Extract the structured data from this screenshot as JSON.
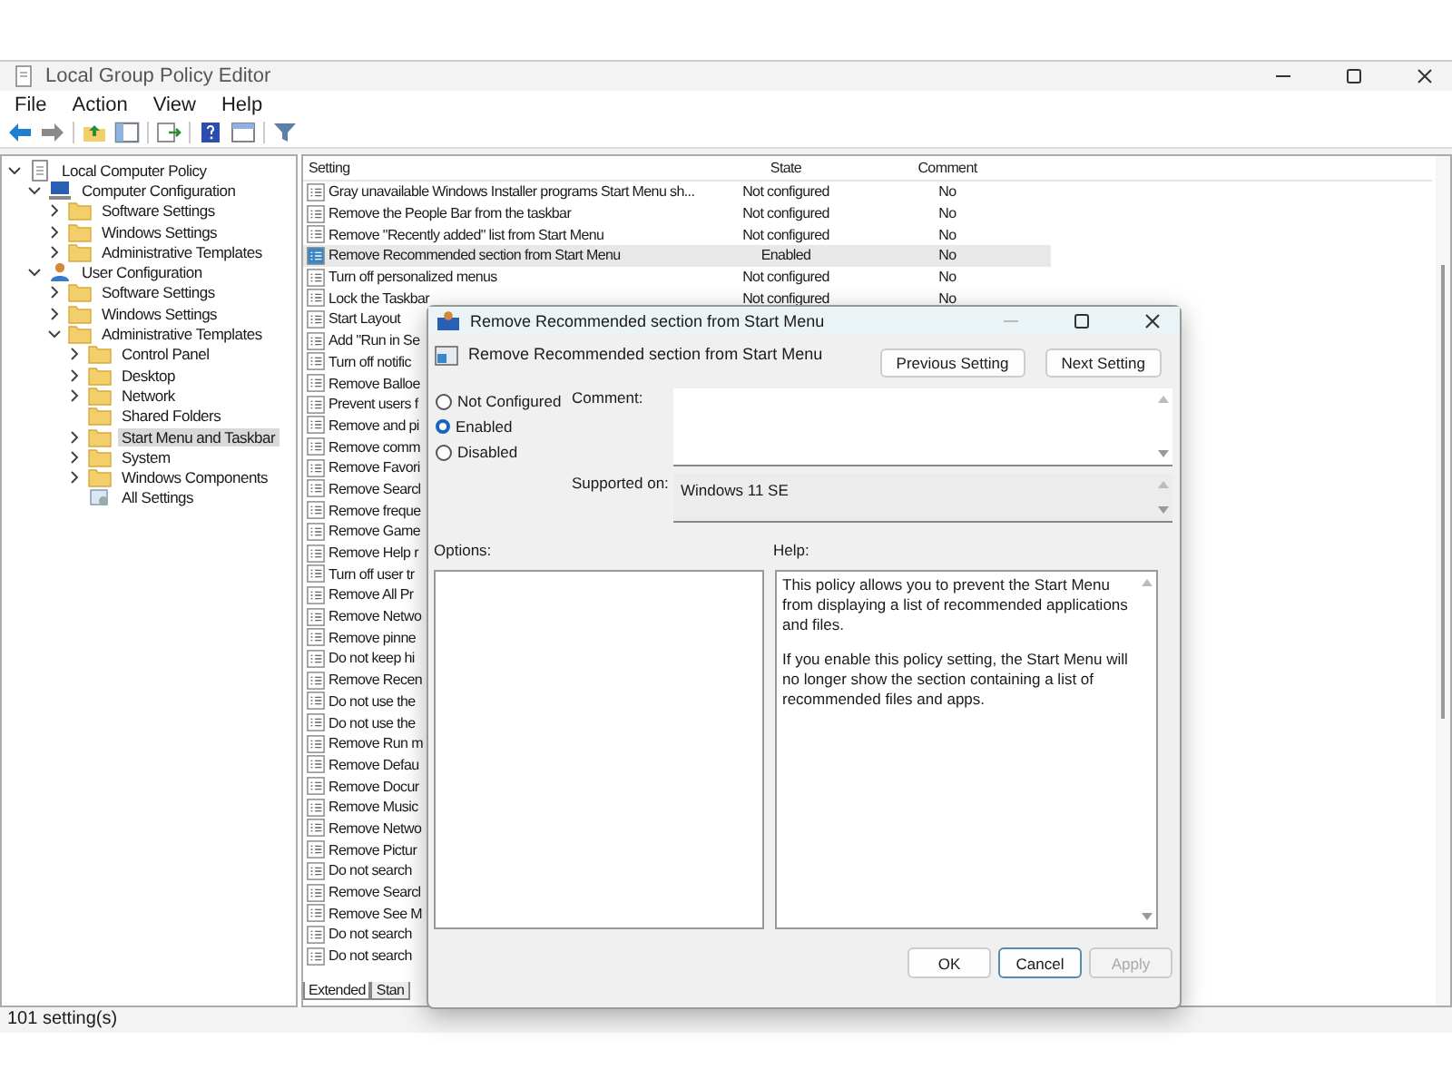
{
  "window": {
    "title": "Local Group Policy Editor"
  },
  "menu": [
    "File",
    "Action",
    "View",
    "Help"
  ],
  "tree": [
    {
      "label": "Local Computer Policy",
      "kind": "policy",
      "expanded": true,
      "selected": false,
      "children": [
        {
          "label": "Computer Configuration",
          "kind": "computer",
          "expanded": true,
          "selected": false,
          "children": [
            {
              "label": "Software Settings",
              "kind": "folder",
              "expanded": false,
              "selected": false
            },
            {
              "label": "Windows Settings",
              "kind": "folder",
              "expanded": false,
              "selected": false
            },
            {
              "label": "Administrative Templates",
              "kind": "folder",
              "expanded": false,
              "selected": false
            }
          ]
        },
        {
          "label": "User Configuration",
          "kind": "user",
          "expanded": true,
          "selected": false,
          "children": [
            {
              "label": "Software Settings",
              "kind": "folder",
              "expanded": false,
              "selected": false
            },
            {
              "label": "Windows Settings",
              "kind": "folder",
              "expanded": false,
              "selected": false
            },
            {
              "label": "Administrative Templates",
              "kind": "folder",
              "expanded": true,
              "selected": false,
              "children": [
                {
                  "label": "Control Panel",
                  "kind": "folder",
                  "expanded": false,
                  "selected": false
                },
                {
                  "label": "Desktop",
                  "kind": "folder",
                  "expanded": false,
                  "selected": false
                },
                {
                  "label": "Network",
                  "kind": "folder",
                  "expanded": false,
                  "selected": false
                },
                {
                  "label": "Shared Folders",
                  "kind": "leaf",
                  "selected": false
                },
                {
                  "label": "Start Menu and Taskbar",
                  "kind": "folder",
                  "expanded": false,
                  "selected": true
                },
                {
                  "label": "System",
                  "kind": "folder",
                  "expanded": false,
                  "selected": false
                },
                {
                  "label": "Windows Components",
                  "kind": "folder",
                  "expanded": false,
                  "selected": false
                },
                {
                  "label": "All Settings",
                  "kind": "settings",
                  "selected": false
                }
              ]
            }
          ]
        }
      ]
    }
  ],
  "table": {
    "columns": [
      "Setting",
      "State",
      "Comment"
    ],
    "rows": [
      {
        "setting": "Gray unavailable Windows Installer programs Start Menu sh...",
        "state": "Not configured",
        "comment": "No",
        "enabled": false,
        "selected": false
      },
      {
        "setting": "Remove the People Bar from the taskbar",
        "state": "Not configured",
        "comment": "No",
        "enabled": false,
        "selected": false
      },
      {
        "setting": "Remove \"Recently added\" list from Start Menu",
        "state": "Not configured",
        "comment": "No",
        "enabled": false,
        "selected": false
      },
      {
        "setting": "Remove Recommended section from Start Menu",
        "state": "Enabled",
        "comment": "No",
        "enabled": true,
        "selected": true
      },
      {
        "setting": "Turn off personalized menus",
        "state": "Not configured",
        "comment": "No",
        "enabled": false,
        "selected": false
      },
      {
        "setting": "Lock the Taskbar",
        "state": "Not configured",
        "comment": "No",
        "enabled": false,
        "selected": false
      },
      {
        "setting": "Start Layout",
        "enabled": false,
        "selected": false
      },
      {
        "setting": "Add \"Run in Se",
        "enabled": false,
        "selected": false
      },
      {
        "setting": "Turn off notific",
        "enabled": false,
        "selected": false
      },
      {
        "setting": "Remove Balloe",
        "enabled": false,
        "selected": false
      },
      {
        "setting": "Prevent users f",
        "enabled": false,
        "selected": false
      },
      {
        "setting": "Remove and pi",
        "enabled": false,
        "selected": false
      },
      {
        "setting": "Remove comm",
        "enabled": false,
        "selected": false
      },
      {
        "setting": "Remove Favori",
        "enabled": false,
        "selected": false
      },
      {
        "setting": "Remove Searcl",
        "enabled": false,
        "selected": false
      },
      {
        "setting": "Remove freque",
        "enabled": false,
        "selected": false
      },
      {
        "setting": "Remove Game",
        "enabled": false,
        "selected": false
      },
      {
        "setting": "Remove Help r",
        "enabled": false,
        "selected": false
      },
      {
        "setting": "Turn off user tr",
        "enabled": false,
        "selected": false
      },
      {
        "setting": "Remove All Pr",
        "enabled": false,
        "selected": false
      },
      {
        "setting": "Remove Netwo",
        "enabled": false,
        "selected": false
      },
      {
        "setting": "Remove pinne",
        "enabled": false,
        "selected": false
      },
      {
        "setting": "Do not keep hi",
        "enabled": false,
        "selected": false
      },
      {
        "setting": "Remove Recen",
        "enabled": false,
        "selected": false
      },
      {
        "setting": "Do not use the",
        "enabled": false,
        "selected": false
      },
      {
        "setting": "Do not use the",
        "enabled": false,
        "selected": false
      },
      {
        "setting": "Remove Run m",
        "enabled": false,
        "selected": false
      },
      {
        "setting": "Remove Defau",
        "enabled": false,
        "selected": false
      },
      {
        "setting": "Remove Docur",
        "enabled": false,
        "selected": false
      },
      {
        "setting": "Remove Music",
        "enabled": false,
        "selected": false
      },
      {
        "setting": "Remove Netwo",
        "enabled": false,
        "selected": false
      },
      {
        "setting": "Remove Pictur",
        "enabled": false,
        "selected": false
      },
      {
        "setting": "Do not search",
        "enabled": false,
        "selected": false
      },
      {
        "setting": "Remove Searcl",
        "enabled": false,
        "selected": false
      },
      {
        "setting": "Remove See M",
        "enabled": false,
        "selected": false
      },
      {
        "setting": "Do not search",
        "enabled": false,
        "selected": false
      },
      {
        "setting": "Do not search",
        "enabled": false,
        "selected": false
      }
    ]
  },
  "view_tabs": [
    {
      "label": "Extended",
      "selected": true
    },
    {
      "label": "Stan",
      "selected": false
    }
  ],
  "status_bar": "101 setting(s)",
  "dialog": {
    "title": "Remove Recommended section from Start Menu",
    "heading": "Remove Recommended section from Start Menu",
    "nav_buttons": [
      "Previous Setting",
      "Next Setting"
    ],
    "options": [
      {
        "label": "Not Configured",
        "selected": false
      },
      {
        "label": "Enabled",
        "selected": true
      },
      {
        "label": "Disabled",
        "selected": false
      }
    ],
    "comment_label": "Comment:",
    "supported_label": "Supported on:",
    "supported_value": "Windows 11 SE",
    "options_label": "Options:",
    "help_label": "Help:",
    "help": [
      "This policy allows you to prevent the Start Menu from displaying a list of recommended applications and files.",
      "If you enable this policy setting, the Start Menu will no longer show the section containing a list of recommended files and apps."
    ],
    "buttons": [
      {
        "label": "OK",
        "disabled": false
      },
      {
        "label": "Cancel",
        "disabled": false
      },
      {
        "label": "Apply",
        "disabled": true
      }
    ]
  }
}
